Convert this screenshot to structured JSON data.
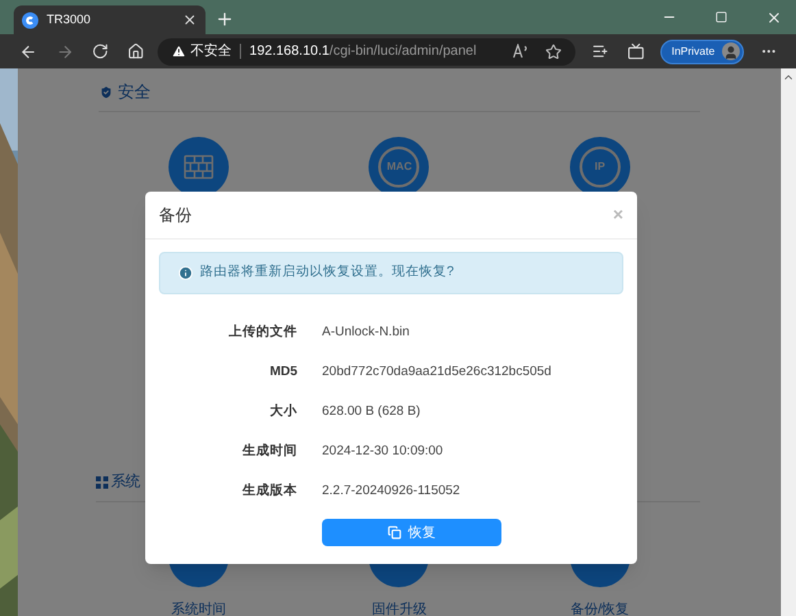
{
  "browser": {
    "tab_title": "TR3000",
    "url_host": "192.168.10.1",
    "url_path": "/cgi-bin/luci/admin/panel",
    "security_label": "不安全",
    "inprivate": "InPrivate"
  },
  "page": {
    "sections": [
      {
        "title": "安全",
        "items": [
          {
            "kind": "firewall"
          },
          {
            "kind": "text",
            "badge": "MAC"
          },
          {
            "kind": "text",
            "badge": "IP"
          }
        ]
      },
      {
        "title": "系统",
        "items": [
          {
            "kind": "plain",
            "label": "系统时间"
          },
          {
            "kind": "plain",
            "label": "固件升级"
          },
          {
            "kind": "plain",
            "label": "备份/恢复"
          }
        ]
      }
    ]
  },
  "modal": {
    "title": "备份",
    "close": "×",
    "alert": "路由器将重新启动以恢复设置。现在恢复?",
    "fields": [
      {
        "label": "上传的文件",
        "value": "A-Unlock-N.bin"
      },
      {
        "label": "MD5",
        "value": "20bd772c70da9aa21d5e26c312bc505d"
      },
      {
        "label": "大小",
        "value": "628.00 B (628 B)"
      },
      {
        "label": "生成时间",
        "value": "2024-12-30 10:09:00"
      },
      {
        "label": "生成版本",
        "value": "2.2.7-20240926-115052"
      }
    ],
    "button": "恢复"
  }
}
